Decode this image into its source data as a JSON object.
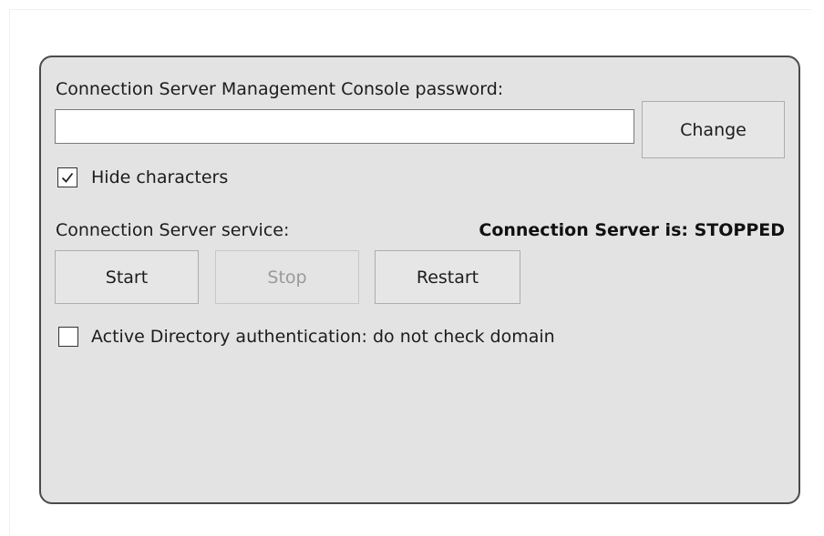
{
  "password_section": {
    "label": "Connection Server Management Console password:",
    "input_value": "",
    "change_button": "Change",
    "hide_characters_label": "Hide characters",
    "hide_characters_checked": true
  },
  "service_section": {
    "label": "Connection Server service:",
    "status": "Connection Server is: STOPPED",
    "buttons": {
      "start": "Start",
      "stop": "Stop",
      "restart": "Restart"
    },
    "stop_enabled": false
  },
  "ad_auth": {
    "label": "Active Directory authentication: do not check domain",
    "checked": false
  },
  "colors": {
    "panel_background": "#e3e3e3",
    "panel_border": "#4a4a4a",
    "disabled_text": "#9a9a9a"
  },
  "icons": {
    "checkmark": "check-icon"
  }
}
